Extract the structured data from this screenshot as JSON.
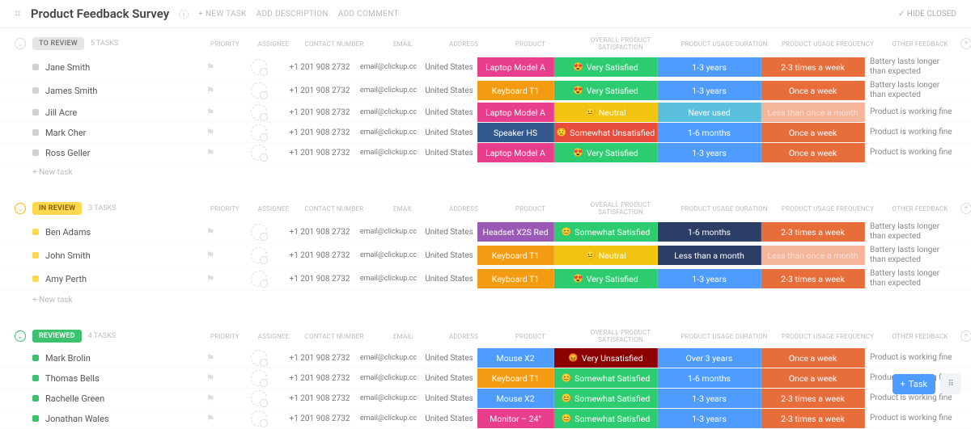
{
  "header": {
    "title": "Product Feedback Survey",
    "new_task": "+ NEW TASK",
    "add_desc": "ADD DESCRIPTION",
    "add_comment": "ADD COMMENT",
    "hide_closed": "✓ HIDE CLOSED"
  },
  "columns": {
    "priority": "PRIORITY",
    "assignee": "ASSIGNEE",
    "contact": "CONTACT NUMBER",
    "email": "EMAIL",
    "address": "ADDRESS",
    "product": "PRODUCT",
    "satisfaction": "OVERALL PRODUCT SATISFACTION",
    "duration": "PRODUCT USAGE DURATION",
    "frequency": "PRODUCT USAGE FREQUENCY",
    "other": "OTHER FEEDBACK"
  },
  "common": {
    "new_task_row": "+ New task",
    "phone": "+1 201 908 2732",
    "email_val": "email@clickup.cc",
    "address_val": "United States"
  },
  "sections": [
    {
      "id": "to-review",
      "label": "TO REVIEW",
      "count": "5 TASKS",
      "badge_class": "badge-grey",
      "collapse_class": "",
      "dot_class": "dot-grey",
      "rows": [
        {
          "name": "Jane Smith",
          "product": "Laptop Model A",
          "product_color": "#e83e8c",
          "sat": "Very Satisfied",
          "sat_emoji": "😍",
          "sat_color": "#2ecc71",
          "dur": "1-3 years",
          "dur_color": "#4e9cff",
          "freq": "2-3 times a week",
          "freq_color": "#e76d3b",
          "freq_muted": false,
          "fb": "Battery lasts longer than expected"
        },
        {
          "name": "James Smith",
          "product": "Keyboard T1",
          "product_color": "#f39c12",
          "sat": "Very Satisfied",
          "sat_emoji": "😍",
          "sat_color": "#2ecc71",
          "dur": "1-3 years",
          "dur_color": "#4e9cff",
          "freq": "Once a week",
          "freq_color": "#e76d3b",
          "freq_muted": false,
          "fb": "Battery lasts longer than expected"
        },
        {
          "name": "Jill Acre",
          "product": "Laptop Model A",
          "product_color": "#e83e8c",
          "sat": "Neutral",
          "sat_emoji": "😐",
          "sat_color": "#f1c40f",
          "dur": "Never used",
          "dur_color": "#5bc0de",
          "freq": "Less than once a month",
          "freq_color": "#f5b59a",
          "freq_muted": true,
          "fb": "Product is working fine"
        },
        {
          "name": "Mark Cher",
          "product": "Speaker HS",
          "product_color": "#34598e",
          "sat": "Somewhat Unsatisfied",
          "sat_emoji": "😟",
          "sat_color": "#e74c3c",
          "dur": "1-6 months",
          "dur_color": "#4e9cff",
          "freq": "Once a week",
          "freq_color": "#e76d3b",
          "freq_muted": false,
          "fb": "Product is working fine"
        },
        {
          "name": "Ross Geller",
          "product": "Laptop Model A",
          "product_color": "#e83e8c",
          "sat": "Very Satisfied",
          "sat_emoji": "😍",
          "sat_color": "#2ecc71",
          "dur": "1-3 years",
          "dur_color": "#4e9cff",
          "freq": "Once a week",
          "freq_color": "#e76d3b",
          "freq_muted": false,
          "fb": "Product is working fine"
        }
      ]
    },
    {
      "id": "in-review",
      "label": "IN REVIEW",
      "count": "3 TASKS",
      "badge_class": "badge-yellow",
      "collapse_class": "yellow",
      "dot_class": "dot-yellow",
      "rows": [
        {
          "name": "Ben Adams",
          "product": "Headset X2S Red",
          "product_color": "#9b59b6",
          "sat": "Somewhat Satisfied",
          "sat_emoji": "😊",
          "sat_color": "#2ecc71",
          "dur": "1-6 months",
          "dur_color": "#2c3e66",
          "freq": "2-3 times a week",
          "freq_color": "#e76d3b",
          "freq_muted": false,
          "fb": "Battery lasts longer than expected"
        },
        {
          "name": "John Smith",
          "product": "Keyboard T1",
          "product_color": "#f39c12",
          "sat": "Neutral",
          "sat_emoji": "😐",
          "sat_color": "#f1c40f",
          "dur": "Less than a month",
          "dur_color": "#2c3e66",
          "freq": "Less than once a month",
          "freq_color": "#f5b59a",
          "freq_muted": true,
          "fb": "Battery lasts longer than expected"
        },
        {
          "name": "Amy Perth",
          "product": "Keyboard T1",
          "product_color": "#f39c12",
          "sat": "Very Satisfied",
          "sat_emoji": "😍",
          "sat_color": "#2ecc71",
          "dur": "1-3 years",
          "dur_color": "#4e9cff",
          "freq": "2-3 times a week",
          "freq_color": "#e76d3b",
          "freq_muted": false,
          "fb": "Battery lasts longer than expected"
        }
      ]
    },
    {
      "id": "reviewed",
      "label": "REVIEWED",
      "count": "4 TASKS",
      "badge_class": "badge-green",
      "collapse_class": "green",
      "dot_class": "dot-green",
      "rows": [
        {
          "name": "Mark Brolin",
          "product": "Mouse X2",
          "product_color": "#4e9cff",
          "sat": "Very Unsatisfied",
          "sat_emoji": "😡",
          "sat_color": "#8b0000",
          "dur": "Over 3 years",
          "dur_color": "#4e9cff",
          "freq": "Once a week",
          "freq_color": "#e76d3b",
          "freq_muted": false,
          "fb": "Product is working fine"
        },
        {
          "name": "Thomas Bells",
          "product": "Keyboard T1",
          "product_color": "#f39c12",
          "sat": "Somewhat Satisfied",
          "sat_emoji": "😊",
          "sat_color": "#2ecc71",
          "dur": "1-6 months",
          "dur_color": "#4e9cff",
          "freq": "Once a week",
          "freq_color": "#e76d3b",
          "freq_muted": false,
          "fb": "Product is working fine"
        },
        {
          "name": "Rachelle Green",
          "product": "Mouse X2",
          "product_color": "#4e9cff",
          "sat": "Somewhat Satisfied",
          "sat_emoji": "😊",
          "sat_color": "#2ecc71",
          "dur": "1-3 years",
          "dur_color": "#4e9cff",
          "freq": "2-3 times a week",
          "freq_color": "#e76d3b",
          "freq_muted": false,
          "fb": "Product is working fine"
        },
        {
          "name": "Jonathan Wales",
          "product": "Monitor – 24\"",
          "product_color": "#e83e8c",
          "sat": "Somewhat Satisfied",
          "sat_emoji": "😊",
          "sat_color": "#2ecc71",
          "dur": "1-3 years",
          "dur_color": "#4e9cff",
          "freq": "2-3 times a week",
          "freq_color": "#e76d3b",
          "freq_muted": false,
          "fb": "Product is working fine"
        }
      ]
    }
  ],
  "fab": {
    "task": "Task"
  }
}
